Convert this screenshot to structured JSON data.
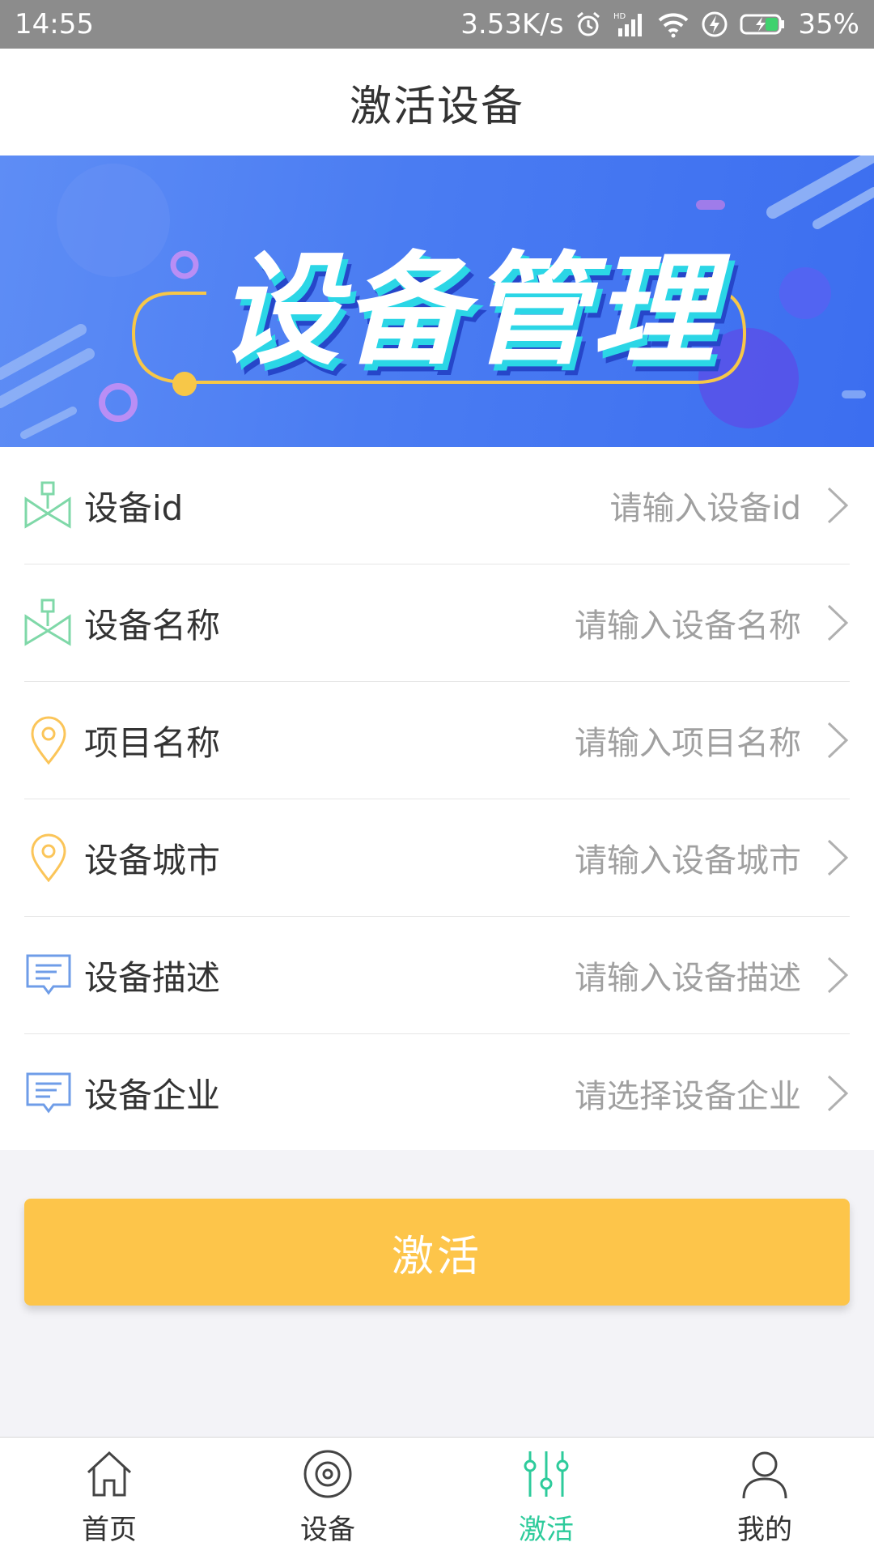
{
  "status_bar": {
    "time": "14:55",
    "network_speed": "3.53K/s",
    "battery": "35%",
    "icons": [
      "alarm-icon",
      "hd-signal-icon",
      "wifi-icon",
      "charging-icon",
      "battery-icon"
    ]
  },
  "header": {
    "title": "激活设备"
  },
  "banner": {
    "title": "设备管理"
  },
  "form": {
    "rows": [
      {
        "icon": "device-icon",
        "label": "设备id",
        "placeholder": "请输入设备id"
      },
      {
        "icon": "device-icon",
        "label": "设备名称",
        "placeholder": "请输入设备名称"
      },
      {
        "icon": "location-pin-icon",
        "label": "项目名称",
        "placeholder": "请输入项目名称"
      },
      {
        "icon": "location-pin-icon",
        "label": "设备城市",
        "placeholder": "请输入设备城市"
      },
      {
        "icon": "message-icon",
        "label": "设备描述",
        "placeholder": "请输入设备描述"
      },
      {
        "icon": "message-icon",
        "label": "设备企业",
        "placeholder": "请选择设备企业"
      }
    ]
  },
  "activate_button": {
    "label": "激活"
  },
  "bottom_nav": {
    "items": [
      {
        "icon": "home-icon",
        "label": "首页",
        "active": false
      },
      {
        "icon": "device-circle-icon",
        "label": "设备",
        "active": false
      },
      {
        "icon": "sliders-icon",
        "label": "激活",
        "active": true
      },
      {
        "icon": "user-icon",
        "label": "我的",
        "active": false
      }
    ]
  },
  "colors": {
    "status_bar": "#8c8c8c",
    "banner_blue": "#4a7cf2",
    "accent_yellow": "#fdc54a",
    "active_green": "#2dcb9b",
    "device_icon_green": "#7fd8a8",
    "pin_icon_yellow": "#fbc559",
    "message_icon_blue": "#6f9de8"
  }
}
